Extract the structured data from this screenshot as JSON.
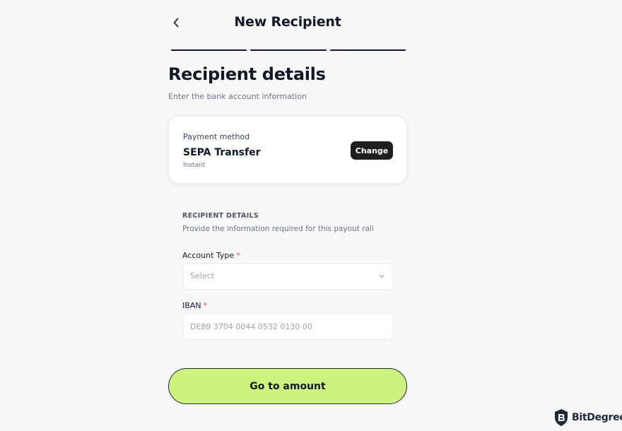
{
  "header": {
    "back_icon": "chevron-left-icon",
    "title": "New Recipient"
  },
  "stepper": {
    "total_steps": 3
  },
  "section": {
    "title": "Recipient details",
    "subtitle": "Enter the bank account information"
  },
  "payment_method": {
    "label": "Payment method",
    "name": "SEPA Transfer",
    "speed": "Instant",
    "change_label": "Change"
  },
  "recipient_details": {
    "heading": "RECIPIENT DETAILS",
    "description": "Provide the information required for this payout rail",
    "account_type": {
      "label": "Account Type",
      "required_mark": "*",
      "placeholder": "Select"
    },
    "iban": {
      "label": "IBAN",
      "required_mark": "*",
      "placeholder": "DE89 3704 0044 0532 0130 00"
    }
  },
  "primary_action": {
    "label": "Go to amount"
  },
  "watermark": {
    "text": "BitDegree",
    "icon": "bitdegree-shield-logo"
  },
  "colors": {
    "accent": "#cdf27e",
    "dark": "#1f1f1f",
    "background": "#f8f8f9",
    "required": "#ef4444"
  }
}
